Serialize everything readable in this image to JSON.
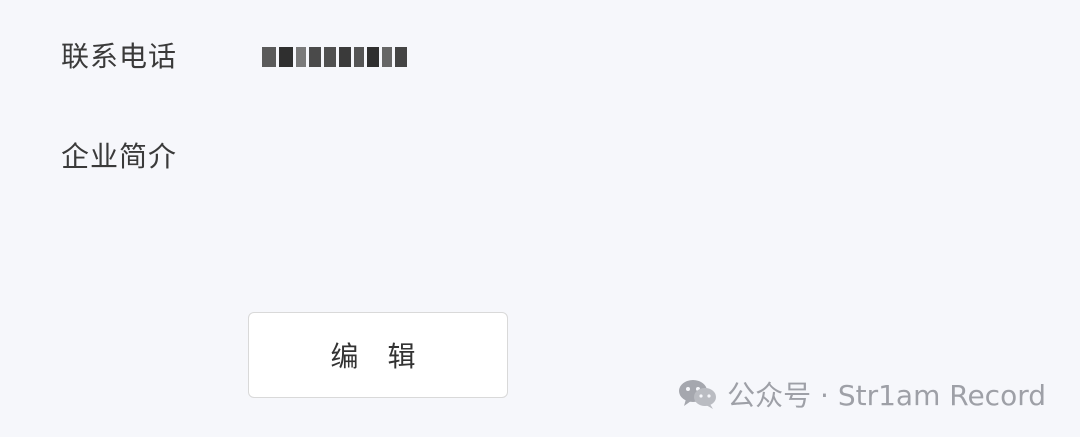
{
  "form": {
    "phone_label": "联系电话",
    "intro_label": "企业简介"
  },
  "actions": {
    "edit_label": "编 辑"
  },
  "watermark": {
    "text": "公众号 · Str1am Record",
    "icon": "wechat-icon"
  },
  "colors": {
    "background": "#f6f7fb",
    "label_text": "#3a3a3a",
    "button_bg": "#ffffff",
    "button_border": "#d9d9d9",
    "watermark": "#9a9ca3"
  }
}
